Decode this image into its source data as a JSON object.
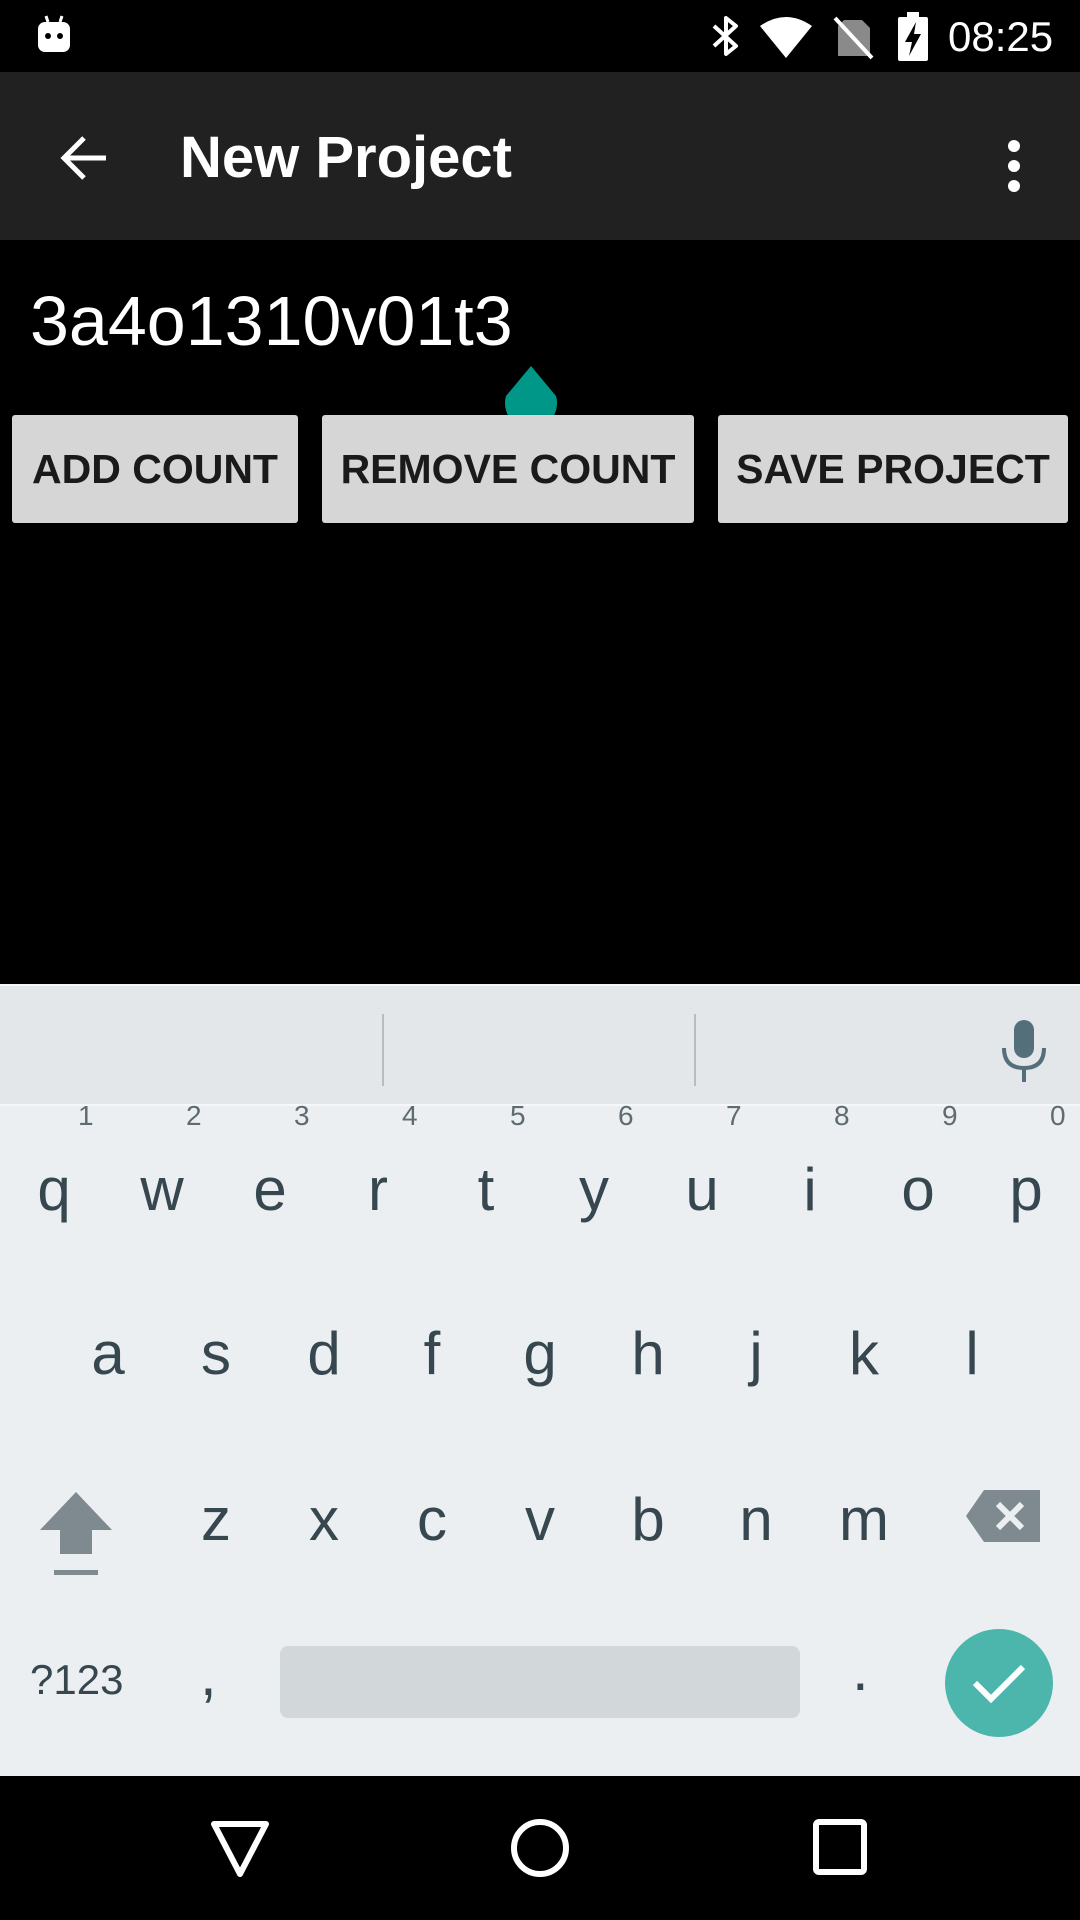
{
  "status_bar": {
    "time": "08:25",
    "icons": [
      "android-icon",
      "bluetooth-icon",
      "wifi-icon",
      "no-sim-icon",
      "battery-charging-icon"
    ]
  },
  "app_bar": {
    "title": "New Project",
    "back_icon": "arrow-back-icon",
    "menu_icon": "more-vert-icon"
  },
  "project": {
    "name_value": "3a4o1310v01t3"
  },
  "buttons": {
    "add_count": "ADD COUNT",
    "remove_count": "REMOVE COUNT",
    "save_project": "SAVE PROJECT"
  },
  "keyboard": {
    "row1": [
      {
        "key": "q",
        "hint": "1"
      },
      {
        "key": "w",
        "hint": "2"
      },
      {
        "key": "e",
        "hint": "3"
      },
      {
        "key": "r",
        "hint": "4"
      },
      {
        "key": "t",
        "hint": "5"
      },
      {
        "key": "y",
        "hint": "6"
      },
      {
        "key": "u",
        "hint": "7"
      },
      {
        "key": "i",
        "hint": "8"
      },
      {
        "key": "o",
        "hint": "9"
      },
      {
        "key": "p",
        "hint": "0"
      }
    ],
    "row2": [
      "a",
      "s",
      "d",
      "f",
      "g",
      "h",
      "j",
      "k",
      "l"
    ],
    "row3": [
      "z",
      "x",
      "c",
      "v",
      "b",
      "n",
      "m"
    ],
    "symbols_label": "?123",
    "comma": ",",
    "period": ".",
    "accent_color": "#4db6ac"
  },
  "colors": {
    "app_bar": "#212121",
    "background": "#000000",
    "cursor_handle": "#009688",
    "button_bg": "#d6d6d6"
  }
}
